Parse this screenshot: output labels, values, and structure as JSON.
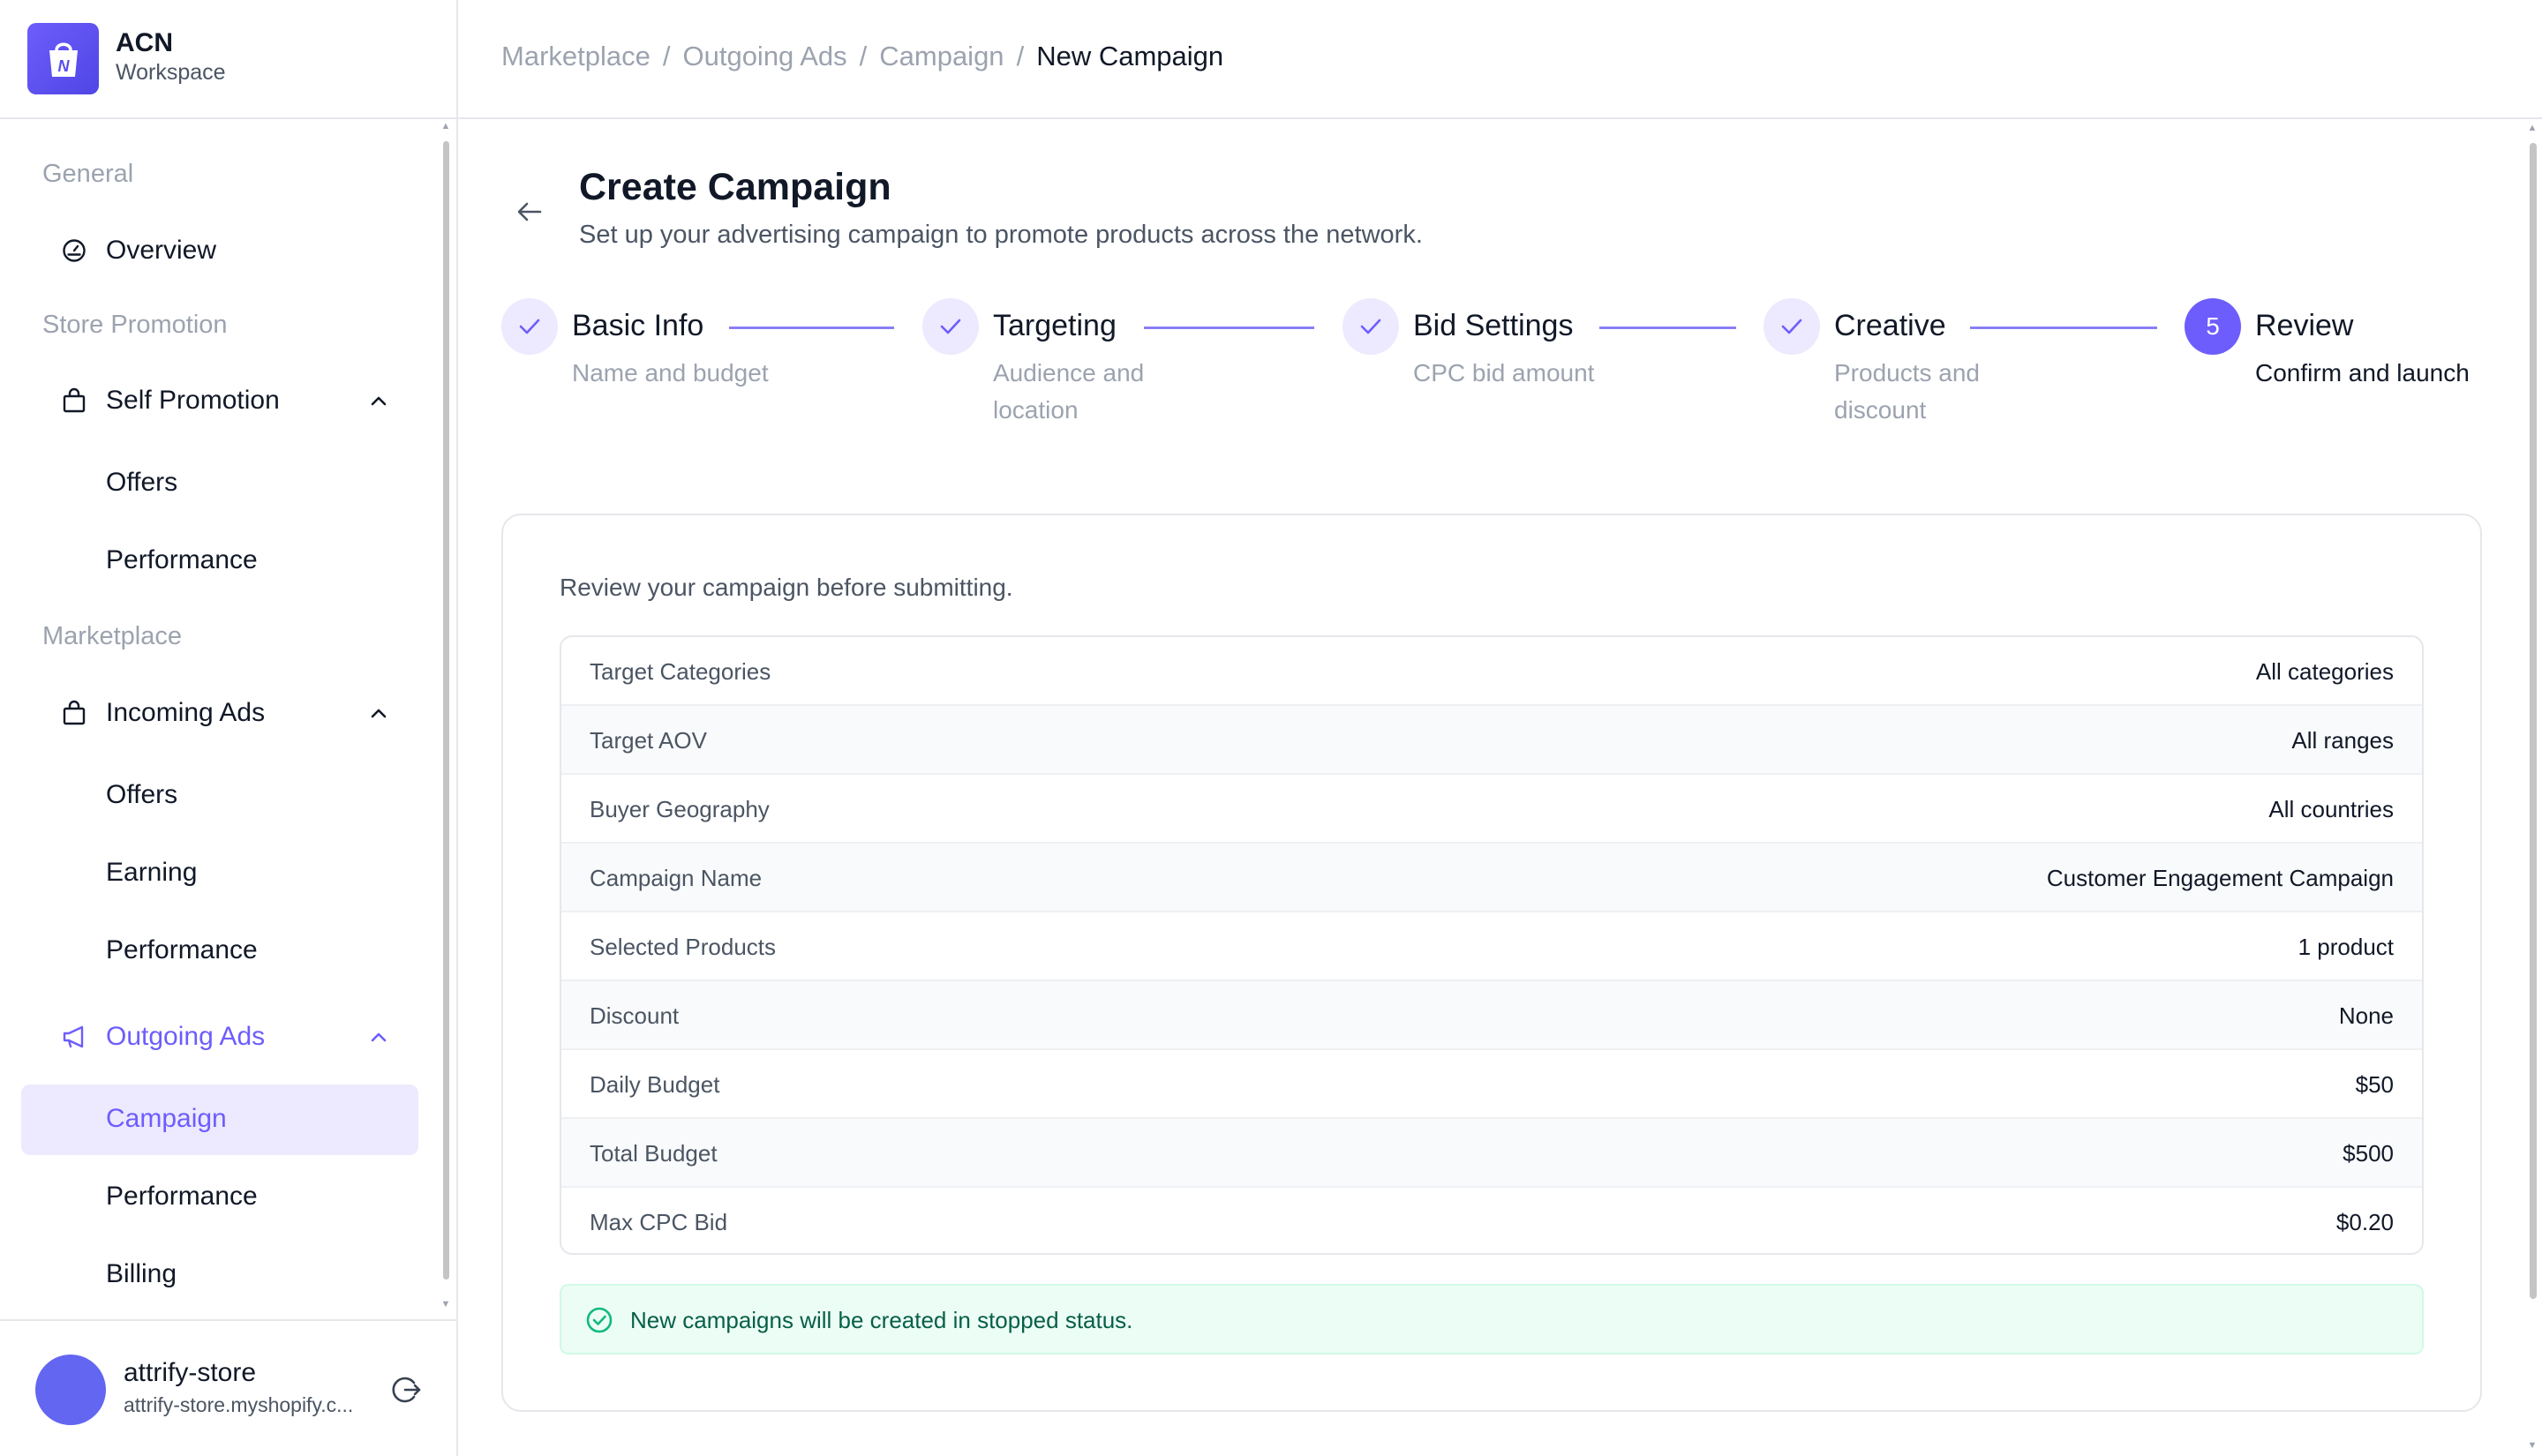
{
  "brand": {
    "title": "ACN",
    "subtitle": "Workspace"
  },
  "sidebar": {
    "sections": [
      {
        "label": "General"
      },
      {
        "label": "Store Promotion"
      },
      {
        "label": "Marketplace"
      }
    ],
    "overview": "Overview",
    "self_promotion": {
      "label": "Self Promotion",
      "children": [
        "Offers",
        "Performance"
      ]
    },
    "incoming_ads": {
      "label": "Incoming Ads",
      "children": [
        "Offers",
        "Earning",
        "Performance"
      ]
    },
    "outgoing_ads": {
      "label": "Outgoing Ads",
      "children": [
        "Campaign",
        "Performance",
        "Billing"
      ],
      "active_child": "Campaign"
    }
  },
  "profile": {
    "name": "attrify-store",
    "domain": "attrify-store.myshopify.c..."
  },
  "breadcrumb": {
    "items": [
      "Marketplace",
      "Outgoing Ads",
      "Campaign"
    ],
    "current": "New Campaign",
    "separator": "/"
  },
  "page": {
    "title": "Create Campaign",
    "description": "Set up your advertising campaign to promote products across the network."
  },
  "steps": [
    {
      "number": "1",
      "title": "Basic Info",
      "desc": "Name and budget",
      "status": "done"
    },
    {
      "number": "2",
      "title": "Targeting",
      "desc": "Audience and location",
      "status": "done"
    },
    {
      "number": "3",
      "title": "Bid Settings",
      "desc": "CPC bid amount",
      "status": "done"
    },
    {
      "number": "4",
      "title": "Creative",
      "desc": "Products and discount",
      "status": "done"
    },
    {
      "number": "5",
      "title": "Review",
      "desc": "Confirm and launch",
      "status": "current"
    }
  ],
  "review": {
    "intro": "Review your campaign before submitting.",
    "rows": [
      {
        "label": "Target Categories",
        "value": "All categories"
      },
      {
        "label": "Target AOV",
        "value": "All ranges"
      },
      {
        "label": "Buyer Geography",
        "value": "All countries"
      },
      {
        "label": "Campaign Name",
        "value": "Customer Engagement Campaign"
      },
      {
        "label": "Selected Products",
        "value": "1 product"
      },
      {
        "label": "Discount",
        "value": "None"
      },
      {
        "label": "Daily Budget",
        "value": "$50"
      },
      {
        "label": "Total Budget",
        "value": "$500"
      },
      {
        "label": "Max CPC Bid",
        "value": "$0.20"
      }
    ],
    "notice": "New campaigns will be created in stopped status."
  },
  "colors": {
    "accent": "#6d5dfc",
    "accent_light": "#ede9fe",
    "success_bg": "#ecfdf5",
    "success_text": "#065f46"
  },
  "icons": {
    "logo": "shopping-bag-logo",
    "overview": "gauge-icon",
    "self_promotion": "shopping-bag-icon",
    "incoming_ads": "shopping-bag-icon",
    "outgoing_ads": "megaphone-icon",
    "back": "arrow-left-icon",
    "step_done": "check-icon",
    "notice": "check-circle-icon",
    "logout": "logout-icon"
  }
}
